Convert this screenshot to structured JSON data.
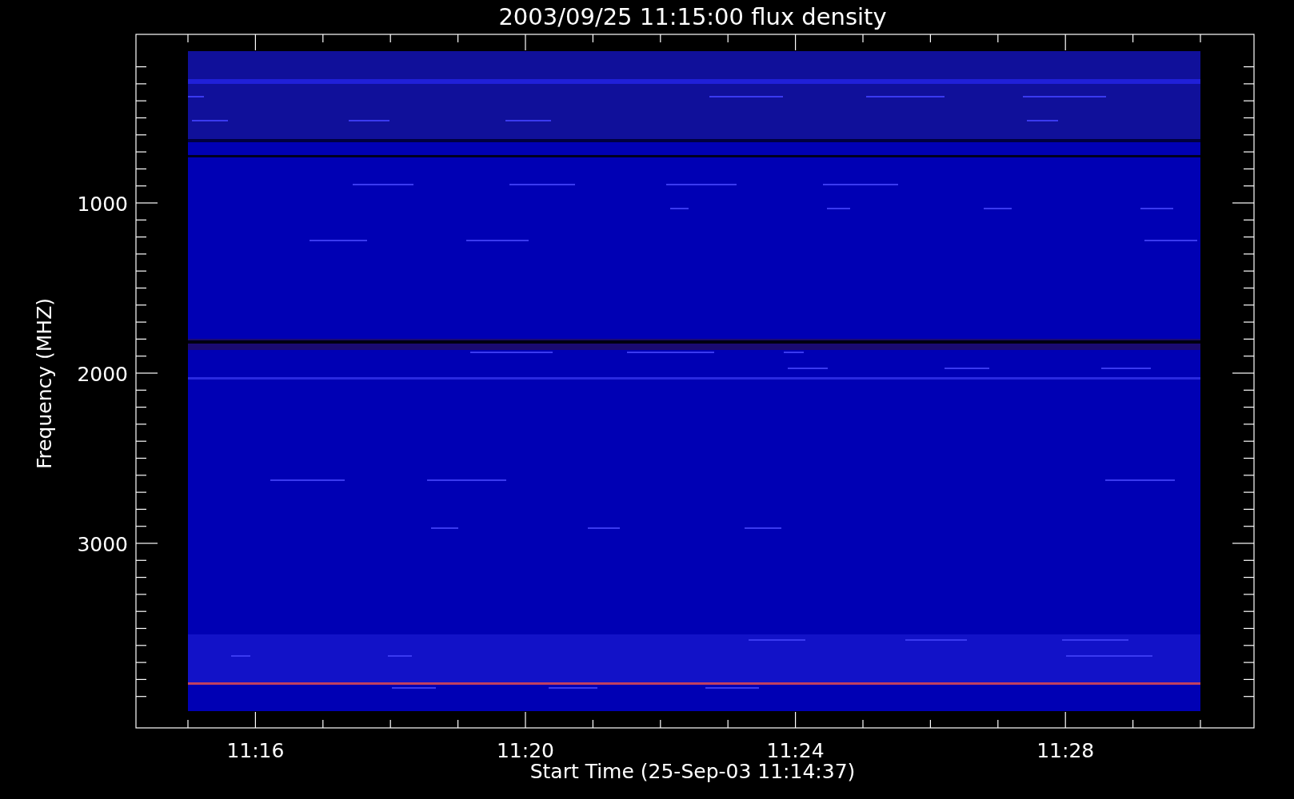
{
  "title": "2003/09/25 11:15:00 flux density",
  "y_axis": {
    "label": "Frequency (MHZ)",
    "ticks": [
      "1000",
      "2000",
      "3000"
    ]
  },
  "x_axis": {
    "label": "Start Time (25-Sep-03 11:14:37)",
    "ticks": [
      "11:16",
      "11:20",
      "11:24",
      "11:28"
    ]
  }
}
